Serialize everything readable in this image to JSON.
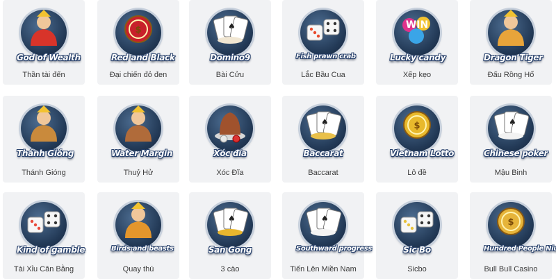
{
  "games": [
    {
      "title": "God of Wealth",
      "caption": "Thần tài đến",
      "icon": "god-of-wealth-icon",
      "accent": "#d8342a"
    },
    {
      "title": "Red and Black",
      "caption": "Đại chiến đỏ đen",
      "icon": "red-and-black-icon",
      "accent": "#c8202a"
    },
    {
      "title": "Domino9",
      "caption": "Bài Cửu",
      "icon": "domino9-icon",
      "accent": "#f0e6d2"
    },
    {
      "title": "Fish prawn crab",
      "caption": "Lắc Bầu Cua",
      "icon": "fish-prawn-crab-icon",
      "accent": "#e84a2c"
    },
    {
      "title": "Lucky candy",
      "caption": "Xếp kẹo",
      "icon": "lucky-candy-icon",
      "accent": "#e0328c"
    },
    {
      "title": "Dragon Tiger",
      "caption": "Đấu Rồng Hổ",
      "icon": "dragon-tiger-icon",
      "accent": "#e8a43a"
    },
    {
      "title": "Thánh Gióng",
      "caption": "Thánh Gióng",
      "icon": "thanh-giong-icon",
      "accent": "#c98a3c"
    },
    {
      "title": "Water Margin",
      "caption": "Thuỷ Hử",
      "icon": "water-margin-icon",
      "accent": "#b06b3a"
    },
    {
      "title": "Xóc đĩa",
      "caption": "Xóc Đĩa",
      "icon": "xoc-dia-icon",
      "accent": "#a0522d"
    },
    {
      "title": "Baccarat",
      "caption": "Baccarat",
      "icon": "baccarat-icon",
      "accent": "#e9c04a"
    },
    {
      "title": "Vietnam Lotto",
      "caption": "Lô đề",
      "icon": "vietnam-lotto-icon",
      "accent": "#e8b92c"
    },
    {
      "title": "Chinese poker",
      "caption": "Mậu Binh",
      "icon": "chinese-poker-icon",
      "accent": "#f2f2f2"
    },
    {
      "title": "Kind of gamble",
      "caption": "Tài Xỉu Cân Bằng",
      "icon": "dice-icon",
      "accent": "#e94a3a"
    },
    {
      "title": "Birds and beasts",
      "caption": "Quay thú",
      "icon": "lion-icon",
      "accent": "#e4962c"
    },
    {
      "title": "San Gong",
      "caption": "3 cào",
      "icon": "san-gong-icon",
      "accent": "#e8b62e"
    },
    {
      "title": "Southward progress",
      "caption": "Tiến Lên Miền Nam",
      "icon": "southward-progress-icon",
      "accent": "#f4f4f4"
    },
    {
      "title": "Sic Bo",
      "caption": "Sicbo",
      "icon": "sic-bo-icon",
      "accent": "#e8c23c"
    },
    {
      "title": "Hundred People Niuniu",
      "caption": "Bull Bull Casino",
      "icon": "niuniu-icon",
      "accent": "#e6b43a"
    }
  ]
}
